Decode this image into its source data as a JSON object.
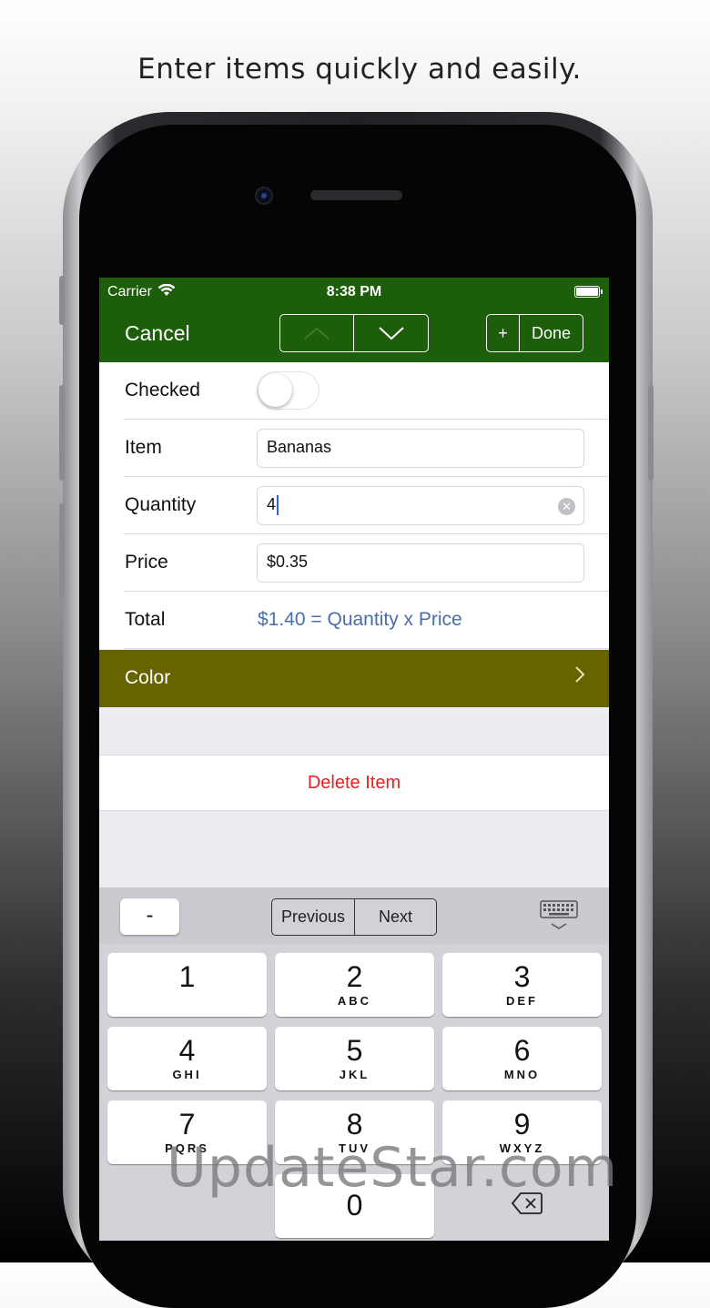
{
  "caption": "Enter items quickly and easily.",
  "status_bar": {
    "carrier": "Carrier",
    "time": "8:38 PM"
  },
  "navbar": {
    "cancel": "Cancel",
    "add": "+",
    "done": "Done"
  },
  "form": {
    "checked_label": "Checked",
    "checked_value": false,
    "item_label": "Item",
    "item_value": "Bananas",
    "quantity_label": "Quantity",
    "quantity_value": "4",
    "price_label": "Price",
    "price_value": "$0.35",
    "total_label": "Total",
    "total_value": "$1.40 = Quantity x Price"
  },
  "color_row": {
    "label": "Color",
    "color": "#676400"
  },
  "delete_row": {
    "label": "Delete Item"
  },
  "accessory": {
    "minus": "-",
    "previous": "Previous",
    "next": "Next"
  },
  "keypad": {
    "keys": [
      {
        "digit": "1",
        "letters": ""
      },
      {
        "digit": "2",
        "letters": "ABC"
      },
      {
        "digit": "3",
        "letters": "DEF"
      },
      {
        "digit": "4",
        "letters": "GHI"
      },
      {
        "digit": "5",
        "letters": "JKL"
      },
      {
        "digit": "6",
        "letters": "MNO"
      },
      {
        "digit": "7",
        "letters": "PQRS"
      },
      {
        "digit": "8",
        "letters": "TUV"
      },
      {
        "digit": "9",
        "letters": "WXYZ"
      },
      {
        "digit": "0",
        "letters": ""
      }
    ]
  },
  "watermark": "UpdateStar.com",
  "colors": {
    "nav_green": "#1d5e0a",
    "delete_red": "#f21c1c",
    "total_blue": "#4a6ea8"
  }
}
